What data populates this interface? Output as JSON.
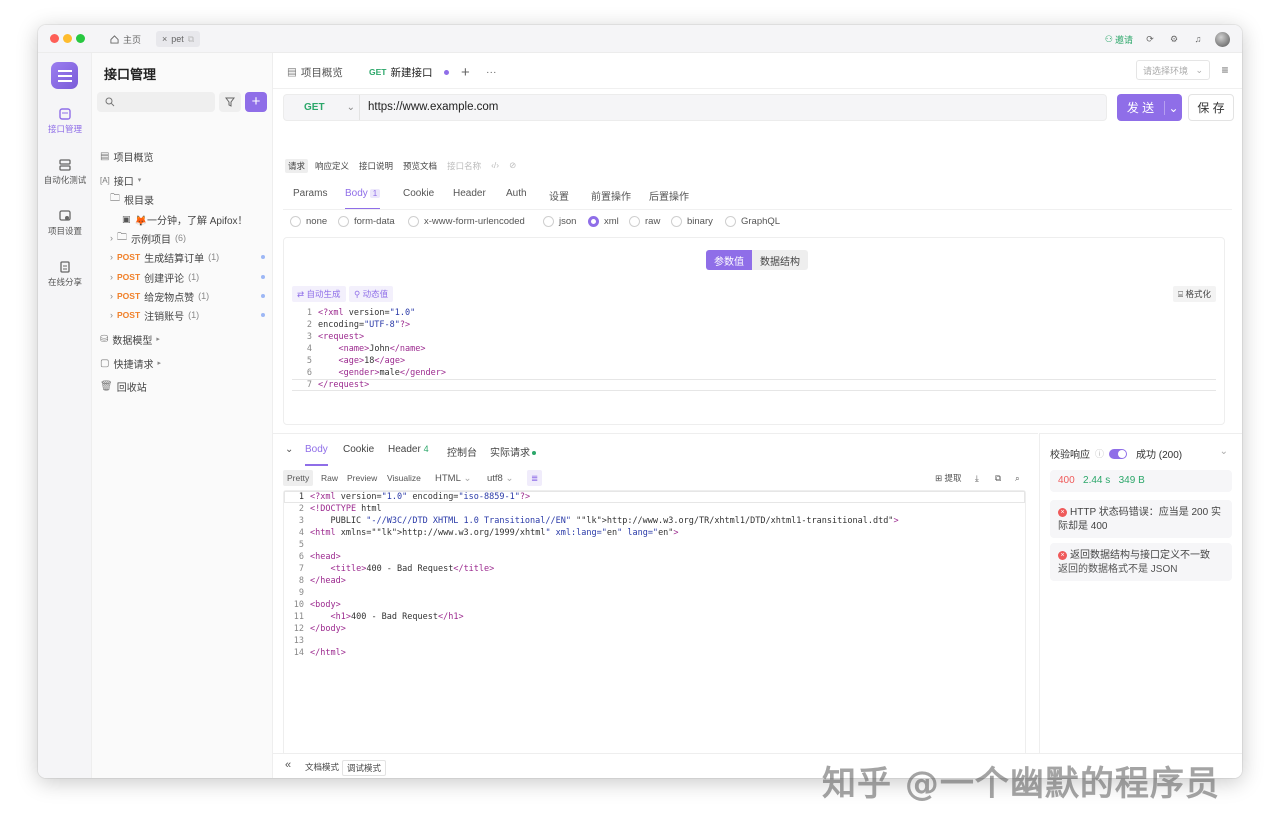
{
  "titlebar": {
    "home_tab": "主页",
    "project_tab": "pet",
    "invite": "邀请"
  },
  "rail": {
    "items": [
      "接口管理",
      "自动化测试",
      "项目设置",
      "在线分享"
    ]
  },
  "sidebar": {
    "title": "接口管理",
    "tree": {
      "overview": "项目概览",
      "api": "接口",
      "root": "根目录",
      "welcome": "🦊一分钟，了解 Apifox！",
      "examples": "示例项目",
      "examples_count": "(6)",
      "endpoints": [
        {
          "method": "POST",
          "name": "生成结算订单",
          "count": "(1)"
        },
        {
          "method": "POST",
          "name": "创建评论",
          "count": "(1)"
        },
        {
          "method": "POST",
          "name": "给宠物点赞",
          "count": "(1)"
        },
        {
          "method": "POST",
          "name": "注销账号",
          "count": "(1)"
        }
      ],
      "models": "数据模型",
      "quick": "快捷请求",
      "trash": "回收站"
    }
  },
  "tabs": {
    "overview": "项目概览",
    "new_api_method": "GET",
    "new_api": "新建接口",
    "env_placeholder": "请选择环境"
  },
  "request": {
    "method": "GET",
    "url": "https://www.example.com",
    "send": "发 送",
    "save": "保 存",
    "subtabs": [
      "请求",
      "响应定义",
      "接口说明",
      "预览文档",
      "接口名称"
    ],
    "param_tabs": [
      "Params",
      "Body",
      "Cookie",
      "Header",
      "Auth",
      "设置",
      "前置操作",
      "后置操作"
    ],
    "body_count": "1",
    "body_types": [
      "none",
      "form-data",
      "x-www-form-urlencoded",
      "json",
      "xml",
      "raw",
      "binary",
      "GraphQL"
    ],
    "selected_body_type": "xml",
    "seg_values": "参数值",
    "seg_schema": "数据结构",
    "auto_gen": "自动生成",
    "dynamic": "动态值",
    "format": "格式化",
    "xml_lines": [
      "<?xml version=\"1.0\"",
      "encoding=\"UTF-8\"?>",
      "<request>",
      "    <name>John</name>",
      "    <age>18</age>",
      "    <gender>male</gender>",
      "</request>"
    ]
  },
  "response": {
    "tabs": [
      "Body",
      "Cookie",
      "Header",
      "控制台",
      "实际请求"
    ],
    "header_count": "4",
    "views": [
      "Pretty",
      "Raw",
      "Preview",
      "Visualize"
    ],
    "lang": "HTML",
    "encoding": "utf8",
    "extract": "提取",
    "lines": [
      "<?xml version=\"1.0\" encoding=\"iso-8859-1\"?>",
      "<!DOCTYPE html",
      "    PUBLIC \"-//W3C//DTD XHTML 1.0 Transitional//EN\" \"http://www.w3.org/TR/xhtml1/DTD/xhtml1-transitional.dtd\">",
      "<html xmlns=\"http://www.w3.org/1999/xhtml\" xml:lang=\"en\" lang=\"en\">",
      "",
      "<head>",
      "    <title>400 - Bad Request</title>",
      "</head>",
      "",
      "<body>",
      "    <h1>400 - Bad Request</h1>",
      "</body>",
      "",
      "</html>"
    ]
  },
  "validation": {
    "label": "校验响应",
    "result": "成功 (200)",
    "status": "400",
    "time": "2.44 s",
    "size": "349 B",
    "error1": "HTTP 状态码错误：应当是 200 实际却是 400",
    "error2_title": "返回数据结构与接口定义不一致",
    "error2_detail": "返回的数据格式不是 JSON"
  },
  "footer": {
    "doc_mode": "文档模式",
    "debug_mode": "调试模式"
  },
  "watermark": "知乎 @一个幽默的程序员",
  "colors": {
    "accent": "#8f6ee8",
    "post": "#f0802a",
    "get": "#2ca76a",
    "error": "#ef5a5a"
  }
}
